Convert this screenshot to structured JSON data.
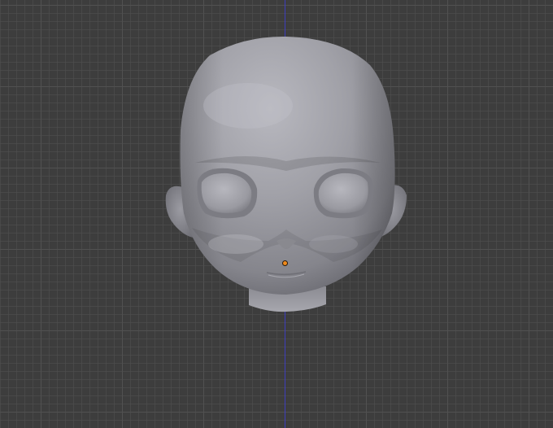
{
  "viewport": {
    "name": "3d-viewport",
    "background_color": "#3d3d3d",
    "grid_color": "#5a5a5a",
    "axis_color": "#3b3bd0"
  },
  "model": {
    "name": "head-mesh",
    "shade_color": "#9a9aa1",
    "origin_color": "#f08a1c"
  }
}
